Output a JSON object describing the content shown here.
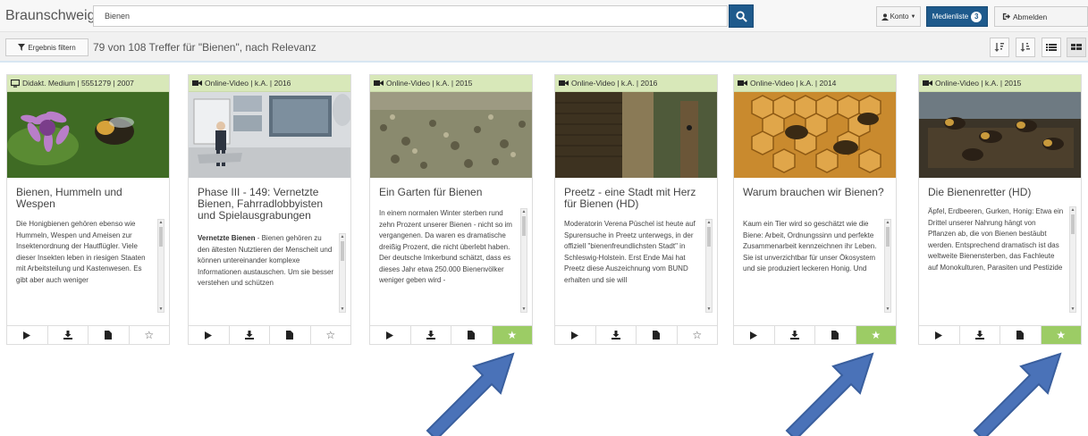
{
  "header": {
    "brand": "Braunschweig",
    "search_value": "Bienen",
    "konto_label": "Konto",
    "medienliste_label": "Medienliste",
    "medienliste_count": "3",
    "abmelden_label": "Abmelden"
  },
  "subbar": {
    "filter_label": "Ergebnis filtern",
    "results_text": "79 von 108 Treffer für \"Bienen\", nach Relevanz"
  },
  "cards": [
    {
      "header": "Didakt. Medium | 5551279 | 2007",
      "header_icon": "monitor-icon",
      "title": "Bienen, Hummeln und Wespen",
      "desc_bold": "",
      "desc": "Die Honigbienen gehören ebenso wie Hummeln, Wespen und Ameisen zur Insektenordnung der Hautflügler. Viele dieser Insekten leben in riesigen Staaten mit Arbeitsteilung und Kastenwesen. Es gibt aber auch weniger",
      "favorited": false
    },
    {
      "header": "Online-Video | k.A. | 2016",
      "header_icon": "video-camera-icon",
      "title": "Phase III - 149: Vernetzte Bienen, Fahrradlobbyisten und Spielausgrabungen",
      "desc_bold": "Vernetzte Bienen",
      "desc": " - Bienen gehören zu den ältesten Nutztieren der Menscheit und können untereinander komplexe Informationen austauschen. Um sie besser verstehen und schützen",
      "favorited": false
    },
    {
      "header": "Online-Video | k.A. | 2015",
      "header_icon": "video-camera-icon",
      "title": "Ein Garten für Bienen",
      "desc_bold": "",
      "desc": "In einem normalen Winter sterben rund zehn Prozent unserer Bienen - nicht so im vergangenen. Da waren es dramatische dreißig Prozent, die nicht überlebt haben. Der deutsche Imkerbund schätzt, dass es dieses Jahr etwa 250.000 Bienenvölker weniger geben wird -",
      "favorited": true
    },
    {
      "header": "Online-Video | k.A. | 2016",
      "header_icon": "video-camera-icon",
      "title": "Preetz - eine Stadt mit Herz für Bienen (HD)",
      "desc_bold": "",
      "desc": "Moderatorin Verena Püschel ist heute auf Spurensuche in Preetz unterwegs, in der offiziell \"bienenfreundlichsten Stadt\" in Schleswig-Holstein. Erst Ende Mai hat Preetz diese Auszeichnung vom BUND erhalten und sie will",
      "favorited": false
    },
    {
      "header": "Online-Video | k.A. | 2014",
      "header_icon": "video-camera-icon",
      "title": "Warum brauchen wir Bienen?",
      "desc_bold": "",
      "desc": "Kaum ein Tier wird so geschätzt wie die Biene: Arbeit, Ordnungssinn und perfekte Zusammenarbeit kennzeichnen ihr Leben. Sie ist unverzichtbar für unser Ökosystem und sie produziert leckeren Honig. Und",
      "favorited": true
    },
    {
      "header": "Online-Video | k.A. | 2015",
      "header_icon": "video-camera-icon",
      "title": "Die Bienenretter (HD)",
      "desc_bold": "",
      "desc": "Äpfel, Erdbeeren, Gurken, Honig: Etwa ein Drittel unserer Nahrung hängt von Pflanzen ab, die von Bienen bestäubt werden. Entsprechend dramatisch ist das weltweite Bienensterben, das Fachleute auf Monokulturen, Parasiten und Pestizide",
      "favorited": true
    }
  ],
  "colors": {
    "primary": "#1e5a8c",
    "card_header": "#d8e8b9",
    "fav_active": "#9ccc65",
    "arrow": "#4a72b8"
  }
}
